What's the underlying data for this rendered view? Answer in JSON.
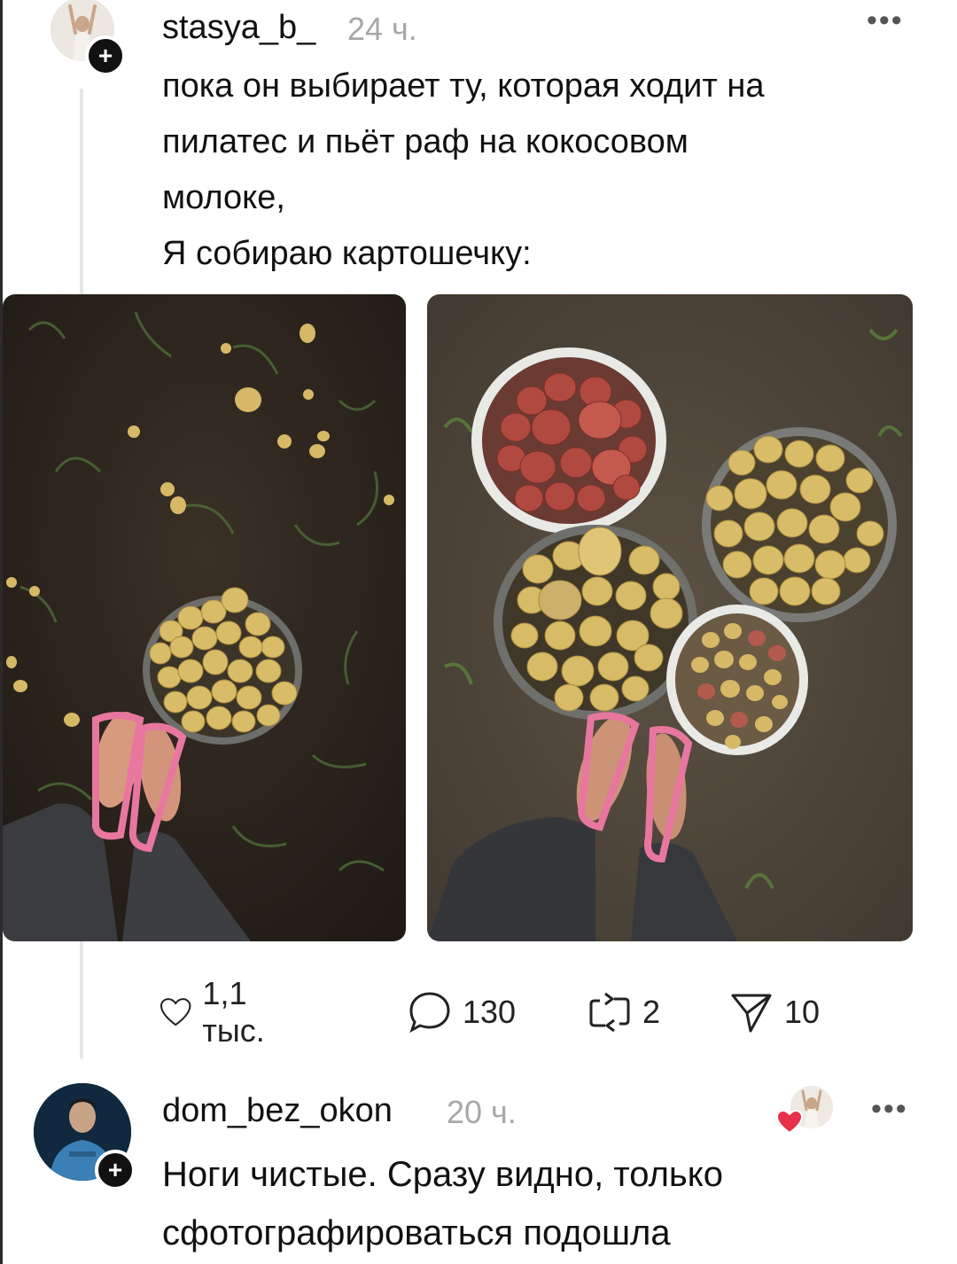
{
  "post": {
    "username": "stasya_b_",
    "time": "24 ч.",
    "lines": [
      "пока он выбирает ту, которая ходит на",
      "пилатес и пьёт раф на кокосовом",
      "молоке,",
      "Я собираю картошечку:"
    ],
    "more_icon": "more-horizontal-icon",
    "photos": [
      "potato-field-photo",
      "potato-buckets-photo"
    ]
  },
  "actions": {
    "likes": "1,1 тыс.",
    "comments": "130",
    "reposts": "2",
    "shares": "10"
  },
  "reply": {
    "username": "dom_bez_okon",
    "time": "20 ч.",
    "lines": [
      "Ноги чистые. Сразу видно, только",
      "сфотографироваться подошла"
    ],
    "liked_by_author": true,
    "heart_color": "#e8304a"
  },
  "colors": {
    "text": "#111111",
    "muted": "#a8a8a8",
    "soil": "#2b241d",
    "potato": "#d7b962",
    "red_potato": "#a8433a",
    "flipflop": "#e8779f"
  }
}
